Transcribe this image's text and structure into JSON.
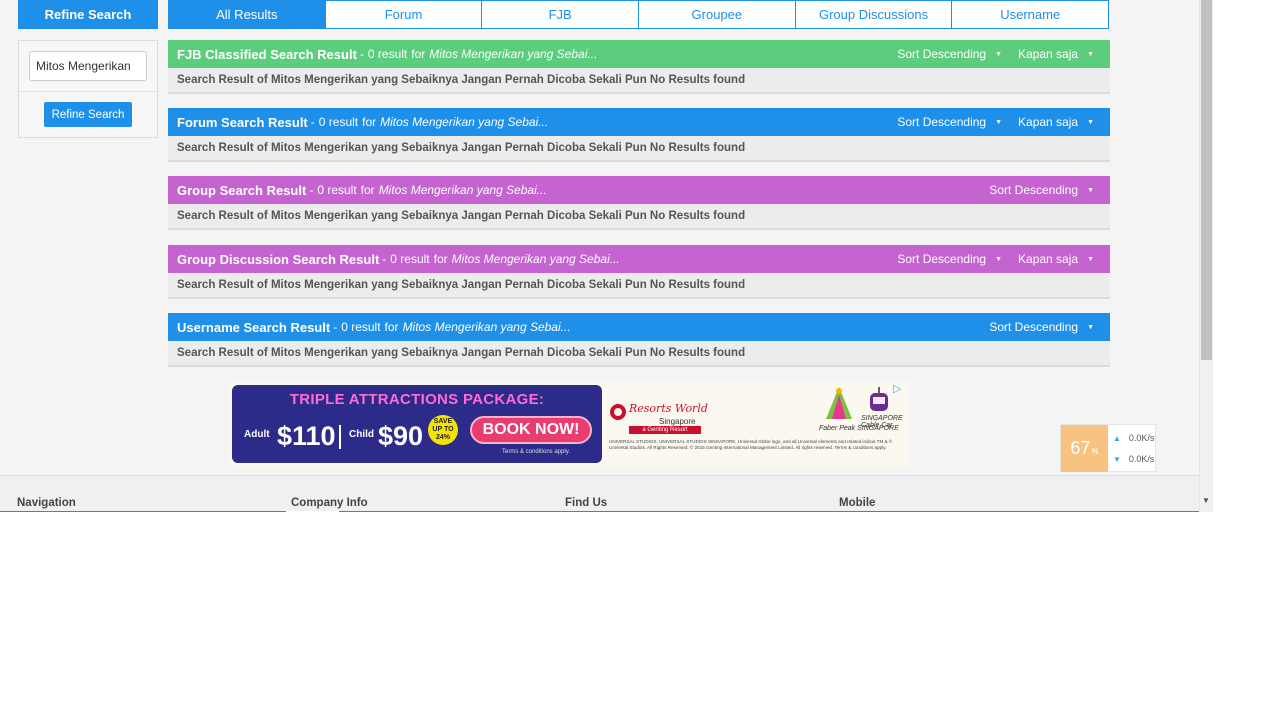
{
  "sidebar": {
    "header": "Refine Search",
    "input_value": "Mitos Mengerikan",
    "button": "Refine Search"
  },
  "tabs": [
    "All Results",
    "Forum",
    "FJB",
    "Groupee",
    "Group Discussions",
    "Username"
  ],
  "query_short": "Mitos Mengerikan yang Sebai...",
  "sections": [
    {
      "title": "FJB Classified Search Result",
      "count": "0 result",
      "sort": "Sort Descending",
      "time": "Kapan saja",
      "message": "Search Result of Mitos Mengerikan yang Sebaiknya Jangan Pernah Dicoba Sekali Pun No Results found",
      "color": "#5ccd7d"
    },
    {
      "title": "Forum Search Result",
      "count": "0 result",
      "sort": "Sort Descending",
      "time": "Kapan saja",
      "message": "Search Result of Mitos Mengerikan yang Sebaiknya Jangan Pernah Dicoba Sekali Pun No Results found",
      "color": "#1e90ea"
    },
    {
      "title": "Group Search Result",
      "count": "0 result",
      "sort": "Sort Descending",
      "message": "Search Result of Mitos Mengerikan yang Sebaiknya Jangan Pernah Dicoba Sekali Pun No Results found",
      "color": "#c564d0"
    },
    {
      "title": "Group Discussion Search Result",
      "count": "0 result",
      "sort": "Sort Descending",
      "time": "Kapan saja",
      "message": "Search Result of Mitos Mengerikan yang Sebaiknya Jangan Pernah Dicoba Sekali Pun No Results found",
      "color": "#c564d0"
    },
    {
      "title": "Username Search Result",
      "count": "0 result",
      "sort": "Sort Descending",
      "message": "Search Result of Mitos Mengerikan yang Sebaiknya Jangan Pernah Dicoba Sekali Pun No Results found",
      "color": "#1e90ea"
    }
  ],
  "common": {
    "dash": "-",
    "for": "for"
  },
  "ad": {
    "title": "TRIPLE ATTRACTIONS PACKAGE:",
    "adult": "Adult",
    "adult_price": "$110",
    "child": "Child",
    "child_price": "$90",
    "save": "SAVE UP TO 24%",
    "book": "BOOK NOW!",
    "terms": "Terms & conditions apply.",
    "brand": "Resorts World",
    "location": "Singapore",
    "genting": "a Genting Resort",
    "faber": "Faber Peak SINGAPORE",
    "cable": "SINGAPORE Cable Car",
    "legal": "UNIVERSAL STUDIOS, UNIVERSAL STUDIOS SINGAPORE, Universal Globe logo, and all Universal elements and related indicia TM & © Universal Studios. All Rights Reserved. © 2015 Genting International Management Limited. All rights reserved. Terms & conditions apply."
  },
  "speed": {
    "percent": "67",
    "percent_sign": "%",
    "up": "0.0K/s",
    "down": "0.0K/s"
  },
  "footer": [
    "Navigation",
    "Company Info",
    "Find Us",
    "Mobile"
  ]
}
